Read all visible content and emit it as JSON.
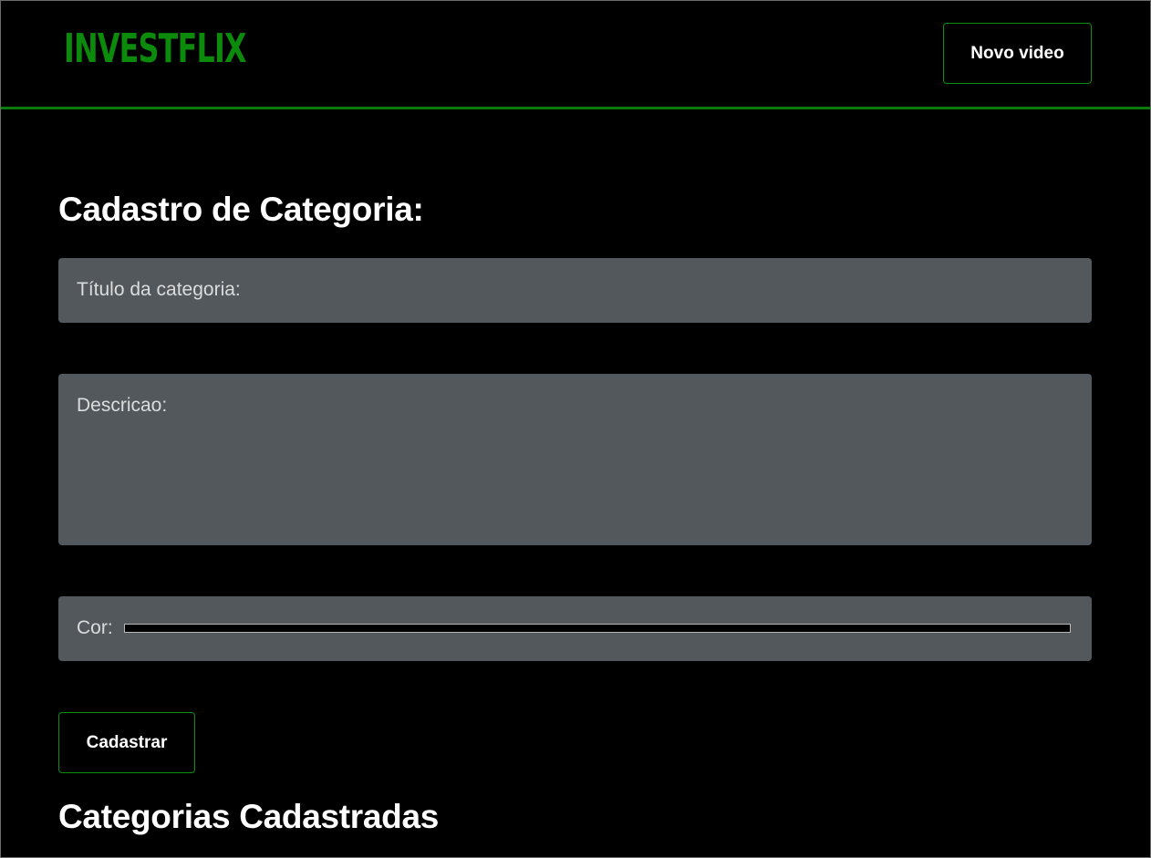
{
  "header": {
    "logo_text": "INVESTFLIX",
    "new_video_label": "Novo video"
  },
  "form": {
    "title": "Cadastro de Categoria:",
    "titulo_label": "Título da categoria:",
    "descricao_label": "Descricao:",
    "cor_label": "Cor:",
    "cor_value": "#000000",
    "submit_label": "Cadastrar"
  },
  "list": {
    "title": "Categorias Cadastradas"
  },
  "colors": {
    "accent": "#0b8a0b",
    "background": "#000000",
    "field_bg": "#53585c",
    "text": "#ffffff"
  }
}
